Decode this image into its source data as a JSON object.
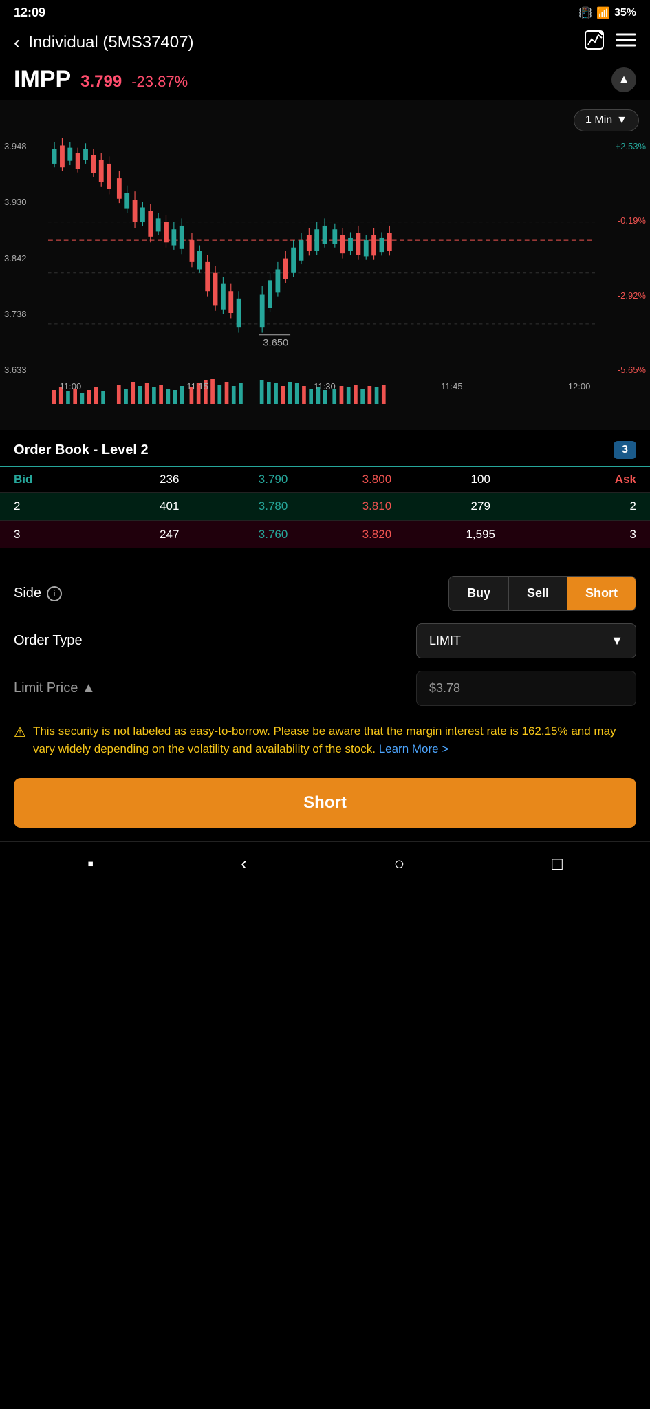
{
  "status": {
    "time": "12:09",
    "battery": "35%"
  },
  "header": {
    "back_label": "‹",
    "title": "Individual (5MS37407)",
    "chart_icon": "📊",
    "menu_icon": "≡"
  },
  "stock": {
    "symbol": "IMPP",
    "price": "3.799",
    "change": "-23.87%",
    "collapse_icon": "▲"
  },
  "chart": {
    "timeframe": "1 Min",
    "price_labels_left": [
      "3.948",
      "3.930",
      "3.842",
      "3.738",
      "3.633"
    ],
    "price_labels_right": [
      "+2.53%",
      "-0.19%",
      "-2.92%",
      "-5.65%"
    ],
    "time_labels": [
      "11:00",
      "11:15",
      "11:30",
      "11:45",
      "12:00"
    ],
    "low_price_label": "3.650"
  },
  "order_book": {
    "title": "Order Book - Level 2",
    "level": "3",
    "headers": {
      "bid": "Bid",
      "ask": "Ask"
    },
    "rows": [
      {
        "bid_qty": "236",
        "bid_price": "3.790",
        "ask_price": "3.800",
        "ask_qty": "100",
        "bid_rank": "",
        "ask_rank": ""
      },
      {
        "bid_qty": "401",
        "bid_price": "3.780",
        "ask_price": "3.810",
        "ask_qty": "279",
        "bid_rank": "2",
        "ask_rank": "2"
      },
      {
        "bid_qty": "247",
        "bid_price": "3.760",
        "ask_price": "3.820",
        "ask_qty": "1,595",
        "bid_rank": "3",
        "ask_rank": "3"
      }
    ]
  },
  "order_form": {
    "side_label": "Side",
    "info_symbol": "i",
    "buy_label": "Buy",
    "sell_label": "Sell",
    "short_label": "Short",
    "order_type_label": "Order Type",
    "order_type_value": "LIMIT",
    "limit_price_label": "Limit Price ▲",
    "limit_price_value": "$3.78"
  },
  "warning": {
    "icon": "⚠",
    "text": "This security is not labeled as easy-to-borrow. Please be aware that the margin interest rate is 162.15% and may vary widely depending on the volatility and availability of the stock.",
    "learn_more": "Learn More >"
  },
  "submit": {
    "label": "Short"
  },
  "bottom_nav": {
    "icons": [
      "▪",
      "‹",
      "○",
      "□"
    ]
  }
}
